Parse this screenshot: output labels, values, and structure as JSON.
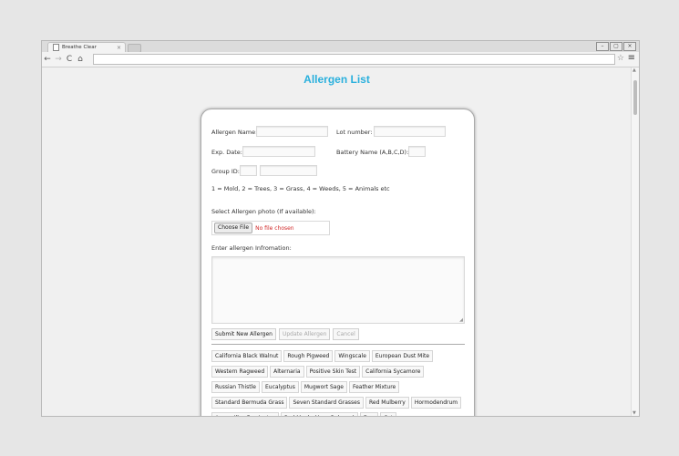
{
  "browser": {
    "tab_title": "Breathe Clear",
    "tab_close": "×",
    "back": "←",
    "forward": "→",
    "reload": "C",
    "home": "⌂",
    "address": "",
    "star": "☆",
    "menu": "≡",
    "controls": [
      "–",
      "▢",
      "×"
    ]
  },
  "page": {
    "title": "Allergen List"
  },
  "form": {
    "allergen_name_label": "Allergen Name:",
    "allergen_name_value": "",
    "lot_number_label": "Lot number:",
    "lot_number_value": "",
    "exp_date_label": "Exp. Date:",
    "exp_date_value": "",
    "battery_name_label": "Battery Name (A,B,C,D):",
    "battery_name_value": "",
    "group_id_label": "Group ID:",
    "group_id_value": "",
    "group_name_value": "",
    "group_legend": "1 = Mold, 2 = Trees, 3 = Grass, 4 = Weeds, 5 = Animals etc",
    "photo_label": "Select Allergen photo (If available):",
    "choose_file_label": "Choose File",
    "no_file_text": "No file chosen",
    "info_label": "Enter allergen Infromation:",
    "info_value": "",
    "submit_label": "Submit New Allergen",
    "update_label": "Update Allergen",
    "cancel_label": "Cancel"
  },
  "allergens": [
    [
      "California Black Walnut",
      "Rough Pigweed",
      "Wingscale",
      "European Dust Mite"
    ],
    [
      "Western Ragweed",
      "Alternaria",
      "Positive Skin Test",
      "California Sycamore"
    ],
    [
      "Russian Thistle",
      "Eucalyptus",
      "Mugwort Sage",
      "Feather Mixture"
    ],
    [
      "Standard Bermuda Grass",
      "Seven Standard Grasses",
      "Red Mulberry",
      "Hormodendrum"
    ],
    [
      "Aspergillus Fumigatus",
      "Red Maple (Acer Rubrum)",
      "Dog",
      "Cat"
    ]
  ],
  "colors": {
    "title": "#2ab0dd",
    "no_file": "#d12a2a"
  }
}
